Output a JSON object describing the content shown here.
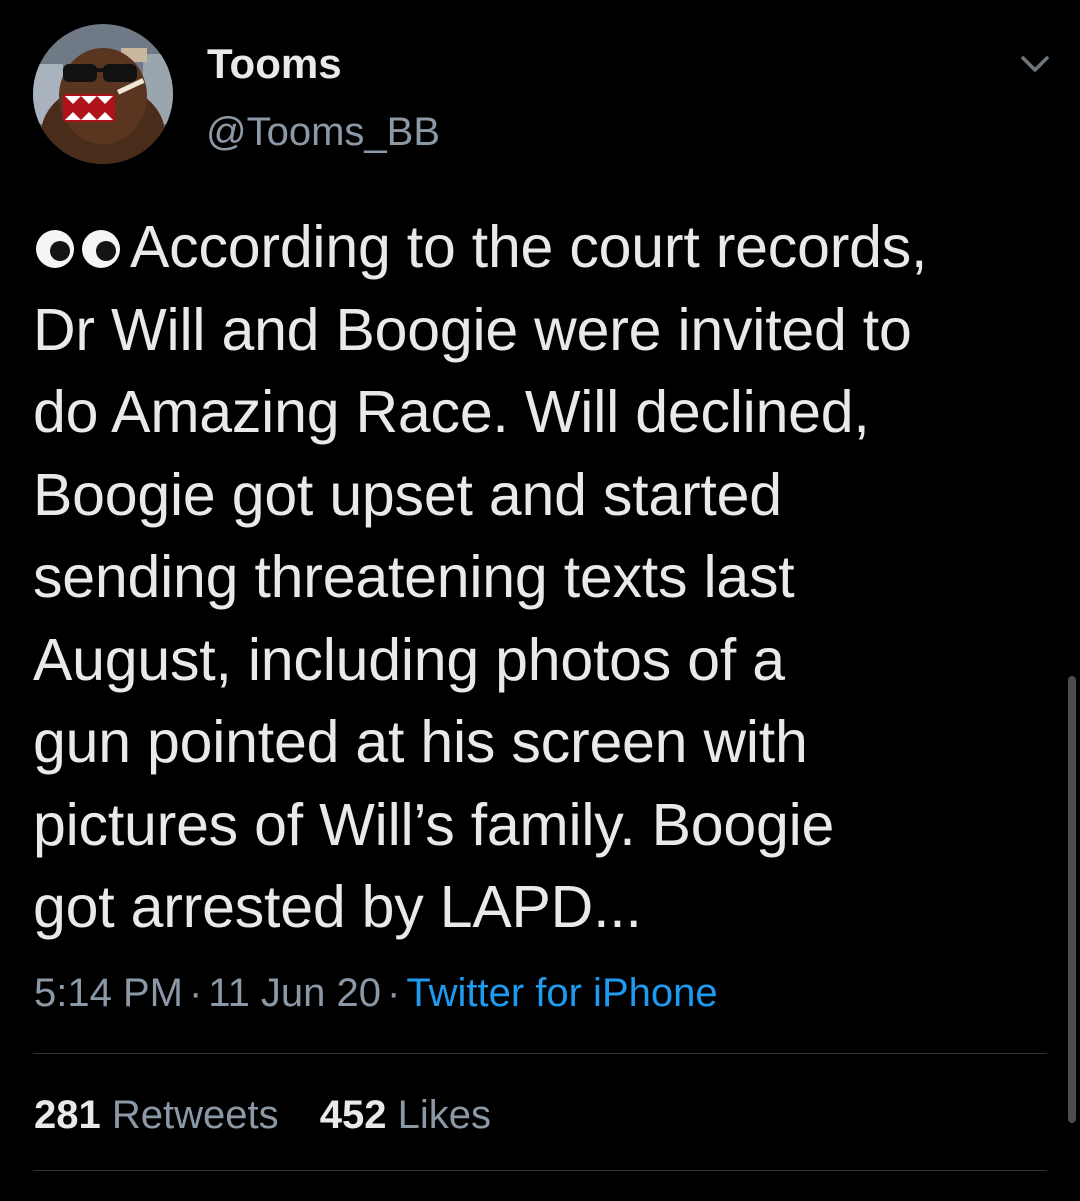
{
  "tweet": {
    "author": {
      "display_name": "Tooms",
      "handle": "@Tooms_BB",
      "avatar_icon": "domo-avatar"
    },
    "menu_icon": "chevron-down-icon",
    "emoji": "eyes-emoji",
    "text": "According to the court records,\nDr Will and Boogie were invited to\ndo Amazing Race. Will declined,\nBoogie got upset and started\nsending threatening texts last\nAugust, including photos of a\ngun pointed at his screen with\npictures of Will’s family. Boogie\ngot arrested by LAPD...",
    "time": "5:14 PM",
    "date": "11 Jun 20",
    "separator": "·",
    "source": "Twitter for iPhone",
    "retweets": {
      "count": "281",
      "label": "Retweets"
    },
    "likes": {
      "count": "452",
      "label": "Likes"
    }
  },
  "colors": {
    "background": "#000000",
    "primary_text": "#e7e9ea",
    "secondary_text": "#8b98a5",
    "link": "#1d9bf0",
    "divider": "#2f3336"
  }
}
